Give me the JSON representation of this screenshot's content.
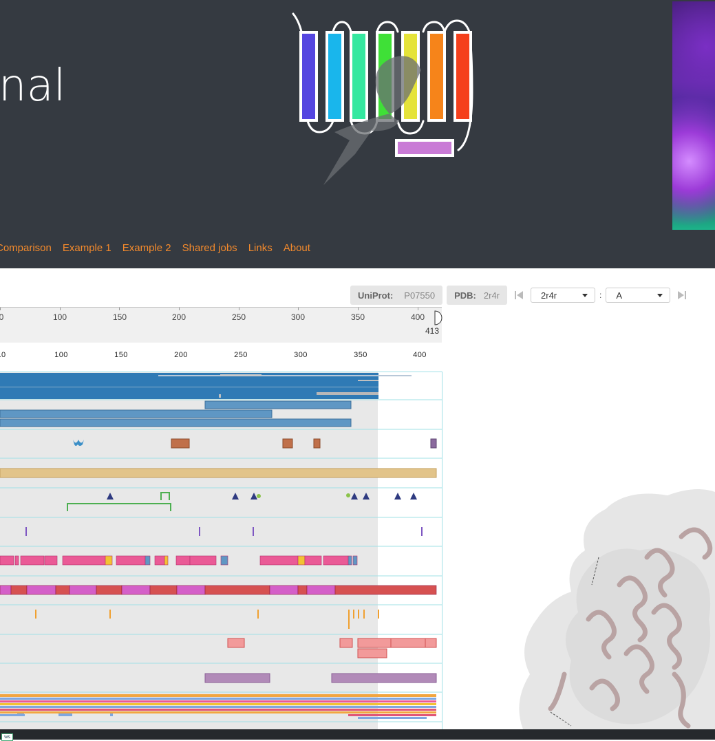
{
  "header": {
    "brand_text": "nal",
    "nav": [
      "Comparison",
      "Example 1",
      "Example 2",
      "Shared jobs",
      "Links",
      "About"
    ]
  },
  "toolbar": {
    "uniprot_label": "UniProt:",
    "uniprot_value": "P07550",
    "pdb_label": "PDB:",
    "pdb_value": "2r4r",
    "pdb_select": "2r4r",
    "chain_separator": ":",
    "chain_select": "A"
  },
  "ruler": {
    "ticks": [
      "0",
      "100",
      "150",
      "200",
      "250",
      "300",
      "350",
      "400"
    ],
    "end_label": "413",
    "ticks2": [
      "10",
      "100",
      "150",
      "200",
      "250",
      "300",
      "350",
      "400"
    ]
  },
  "colors": {
    "header_bg": "#353a41",
    "nav_link": "#f48a2c",
    "track_blue": "#2f7ab5",
    "track_gold": "#e2c48a",
    "track_pink": "#ea5a96",
    "track_magenta": "#d45fc8",
    "track_red": "#e05555",
    "track_purple": "#b18ab8",
    "structure": "#c2aeae"
  }
}
